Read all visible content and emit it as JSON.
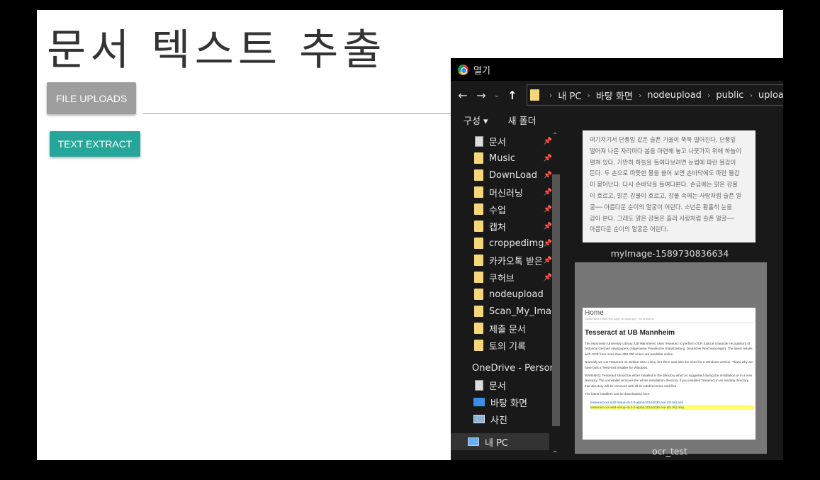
{
  "page": {
    "title": "문서 텍스트 추출",
    "file_upload_label": "FILE UPLOADS",
    "text_extract_label": "TEXT EXTRACT"
  },
  "dialog": {
    "title": "열기",
    "breadcrumb": [
      "내 PC",
      "바탕 화면",
      "nodeupload",
      "public",
      "uploads"
    ],
    "toolbar": {
      "organize": "구성 ▾",
      "new_folder": "새 폴더"
    },
    "nav_items": [
      {
        "label": "문서",
        "pinned": true,
        "icon": "document-icon"
      },
      {
        "label": "Music",
        "pinned": true,
        "icon": "folder-icon"
      },
      {
        "label": "DownLoad",
        "pinned": true,
        "icon": "folder-icon"
      },
      {
        "label": "머신러닝",
        "pinned": true,
        "icon": "folder-icon"
      },
      {
        "label": "수업",
        "pinned": true,
        "icon": "folder-icon"
      },
      {
        "label": "캡처",
        "pinned": true,
        "icon": "folder-icon"
      },
      {
        "label": "croppedimg",
        "pinned": true,
        "icon": "folder-icon"
      },
      {
        "label": "카카오톡 받은",
        "pinned": true,
        "icon": "folder-icon"
      },
      {
        "label": "쿠허브",
        "pinned": true,
        "icon": "folder-icon"
      },
      {
        "label": "nodeupload",
        "pinned": false,
        "icon": "folder-icon"
      },
      {
        "label": "Scan_My_Image",
        "pinned": false,
        "icon": "folder-icon"
      },
      {
        "label": "제출 문서",
        "pinned": false,
        "icon": "folder-icon"
      },
      {
        "label": "토의 기록",
        "pinned": false,
        "icon": "folder-icon"
      },
      {
        "label": "OneDrive - Person",
        "pinned": false,
        "icon": "onedrive-icon"
      },
      {
        "label": "문서",
        "pinned": false,
        "icon": "document-icon"
      },
      {
        "label": "바탕 화면",
        "pinned": false,
        "icon": "desktop-icon"
      },
      {
        "label": "사진",
        "pinned": false,
        "icon": "pictures-icon"
      },
      {
        "label": "내 PC",
        "pinned": false,
        "icon": "pc-icon",
        "selected": true
      }
    ],
    "files": [
      {
        "name": "myImage-1589730836634",
        "preview_lines": [
          "여기저기서 단풍잎 같은 슬픈 기울이 뚝뚝 떨어진다. 단풍잎",
          "떨어져 나온 자리마다 봄을 마련해 놓고 나뭇가지 위에 하늘이",
          "펼쳐 있다. 가만히 하늘을 들여다보려면 눈썹에 파란 물감이",
          "든다. 두 손으로 따뜻한 볼을 쓸어 보면 손바닥에도 파란 물감",
          "이 묻어난다. 다시 손바닥을 들여다본다. 손금에는 맑은 강물",
          "이 흐르고, 맑은 강물이 흐르고, 강물 속에는 사랑처럼 슬픈 얼",
          "굴── 아름다운 순이의 얼굴이 어린다. 소년은 황홀히 눈을",
          "감아 본다. 그래도 맑은 강물은 흘러 사랑처럼 슬픈 얼굴──",
          "아름다운 순이의 얼굴은 어린다."
        ]
      },
      {
        "name": "ocr_test",
        "preview": {
          "home": "Home",
          "meta": "Stefan Weil edited this page 16 days ago · 65 revisions",
          "heading": "Tesseract at UB Mannheim",
          "p1": "The Mannheim University Library (UB Mannheim) uses Tesseract to perform OCR (optical character recognition) of historical German newspapers (Allgemeine Preußische Staatszeitung, Deutscher Reichsanzeiger). The latest results with OCR from more than 360 000 scans are available online.",
          "p2": "Normally we run Tesseract on Debian GNU Linux, but there was also the need for a Windows version. That's why we have built a Tesseract installer for Windows.",
          "p3": "WARNING: Tesseract should be either installed in the directory which is suggested during the installation or in a new directory. The uninstaller removes the whole installation directory. If you installed Tesseract in an existing directory, that directory will be removed with all its subdirectories and files.",
          "p4": "The latest installers can be downloaded here:",
          "li1": "tesseract-ocr-w32-setup-v5.0.0-alpha.20191030.exe (32 bit) and",
          "li2": "tesseract-ocr-w64-setup-v5.0.0-alpha.20191030.exe (64 bit) resp."
        }
      }
    ]
  }
}
